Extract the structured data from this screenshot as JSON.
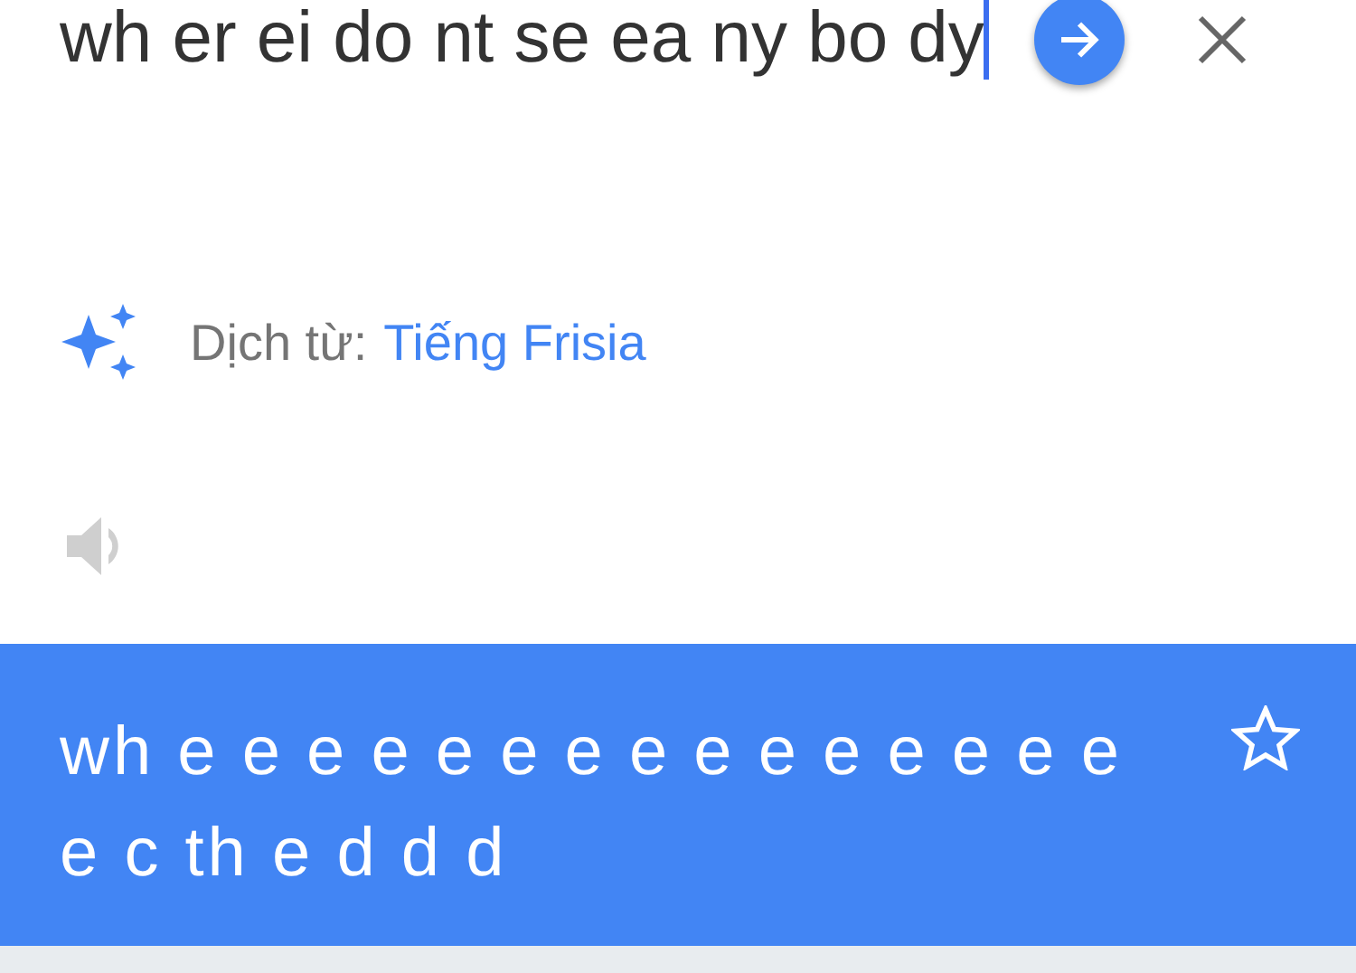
{
  "input": {
    "value": "wh er ei do nt se ea ny bo dy"
  },
  "detect": {
    "label": "Dịch từ:",
    "language": "Tiếng Frisia"
  },
  "translation": {
    "text": "wh e e e e e e e e e e e e e e e e c th e d d d",
    "starred": false
  }
}
